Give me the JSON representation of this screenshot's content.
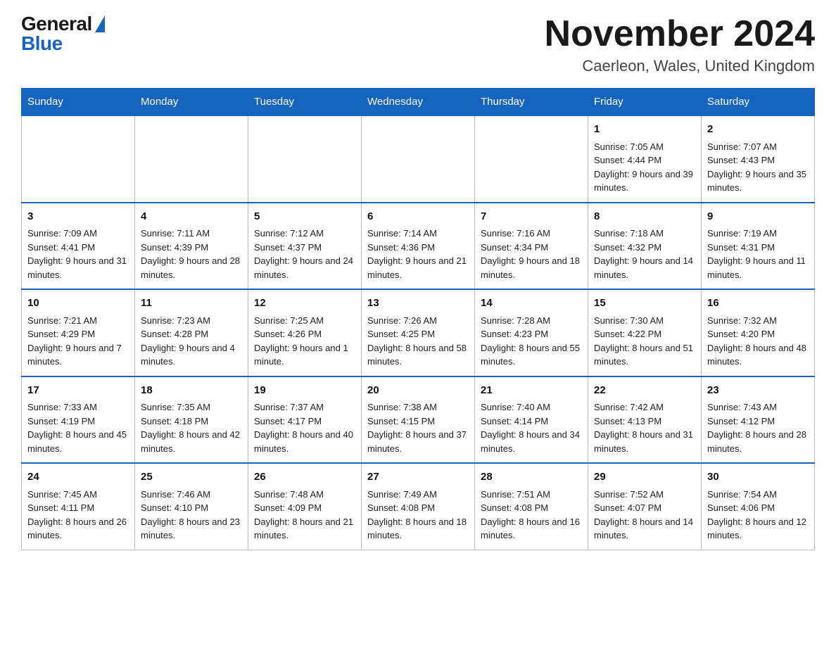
{
  "header": {
    "logo_general": "General",
    "logo_blue": "Blue",
    "title": "November 2024",
    "location": "Caerleon, Wales, United Kingdom"
  },
  "days_of_week": [
    "Sunday",
    "Monday",
    "Tuesday",
    "Wednesday",
    "Thursday",
    "Friday",
    "Saturday"
  ],
  "weeks": [
    [
      {
        "day": "",
        "empty": true
      },
      {
        "day": "",
        "empty": true
      },
      {
        "day": "",
        "empty": true
      },
      {
        "day": "",
        "empty": true
      },
      {
        "day": "",
        "empty": true
      },
      {
        "day": "1",
        "sunrise": "7:05 AM",
        "sunset": "4:44 PM",
        "daylight": "9 hours and 39 minutes."
      },
      {
        "day": "2",
        "sunrise": "7:07 AM",
        "sunset": "4:43 PM",
        "daylight": "9 hours and 35 minutes."
      }
    ],
    [
      {
        "day": "3",
        "sunrise": "7:09 AM",
        "sunset": "4:41 PM",
        "daylight": "9 hours and 31 minutes."
      },
      {
        "day": "4",
        "sunrise": "7:11 AM",
        "sunset": "4:39 PM",
        "daylight": "9 hours and 28 minutes."
      },
      {
        "day": "5",
        "sunrise": "7:12 AM",
        "sunset": "4:37 PM",
        "daylight": "9 hours and 24 minutes."
      },
      {
        "day": "6",
        "sunrise": "7:14 AM",
        "sunset": "4:36 PM",
        "daylight": "9 hours and 21 minutes."
      },
      {
        "day": "7",
        "sunrise": "7:16 AM",
        "sunset": "4:34 PM",
        "daylight": "9 hours and 18 minutes."
      },
      {
        "day": "8",
        "sunrise": "7:18 AM",
        "sunset": "4:32 PM",
        "daylight": "9 hours and 14 minutes."
      },
      {
        "day": "9",
        "sunrise": "7:19 AM",
        "sunset": "4:31 PM",
        "daylight": "9 hours and 11 minutes."
      }
    ],
    [
      {
        "day": "10",
        "sunrise": "7:21 AM",
        "sunset": "4:29 PM",
        "daylight": "9 hours and 7 minutes."
      },
      {
        "day": "11",
        "sunrise": "7:23 AM",
        "sunset": "4:28 PM",
        "daylight": "9 hours and 4 minutes."
      },
      {
        "day": "12",
        "sunrise": "7:25 AM",
        "sunset": "4:26 PM",
        "daylight": "9 hours and 1 minute."
      },
      {
        "day": "13",
        "sunrise": "7:26 AM",
        "sunset": "4:25 PM",
        "daylight": "8 hours and 58 minutes."
      },
      {
        "day": "14",
        "sunrise": "7:28 AM",
        "sunset": "4:23 PM",
        "daylight": "8 hours and 55 minutes."
      },
      {
        "day": "15",
        "sunrise": "7:30 AM",
        "sunset": "4:22 PM",
        "daylight": "8 hours and 51 minutes."
      },
      {
        "day": "16",
        "sunrise": "7:32 AM",
        "sunset": "4:20 PM",
        "daylight": "8 hours and 48 minutes."
      }
    ],
    [
      {
        "day": "17",
        "sunrise": "7:33 AM",
        "sunset": "4:19 PM",
        "daylight": "8 hours and 45 minutes."
      },
      {
        "day": "18",
        "sunrise": "7:35 AM",
        "sunset": "4:18 PM",
        "daylight": "8 hours and 42 minutes."
      },
      {
        "day": "19",
        "sunrise": "7:37 AM",
        "sunset": "4:17 PM",
        "daylight": "8 hours and 40 minutes."
      },
      {
        "day": "20",
        "sunrise": "7:38 AM",
        "sunset": "4:15 PM",
        "daylight": "8 hours and 37 minutes."
      },
      {
        "day": "21",
        "sunrise": "7:40 AM",
        "sunset": "4:14 PM",
        "daylight": "8 hours and 34 minutes."
      },
      {
        "day": "22",
        "sunrise": "7:42 AM",
        "sunset": "4:13 PM",
        "daylight": "8 hours and 31 minutes."
      },
      {
        "day": "23",
        "sunrise": "7:43 AM",
        "sunset": "4:12 PM",
        "daylight": "8 hours and 28 minutes."
      }
    ],
    [
      {
        "day": "24",
        "sunrise": "7:45 AM",
        "sunset": "4:11 PM",
        "daylight": "8 hours and 26 minutes."
      },
      {
        "day": "25",
        "sunrise": "7:46 AM",
        "sunset": "4:10 PM",
        "daylight": "8 hours and 23 minutes."
      },
      {
        "day": "26",
        "sunrise": "7:48 AM",
        "sunset": "4:09 PM",
        "daylight": "8 hours and 21 minutes."
      },
      {
        "day": "27",
        "sunrise": "7:49 AM",
        "sunset": "4:08 PM",
        "daylight": "8 hours and 18 minutes."
      },
      {
        "day": "28",
        "sunrise": "7:51 AM",
        "sunset": "4:08 PM",
        "daylight": "8 hours and 16 minutes."
      },
      {
        "day": "29",
        "sunrise": "7:52 AM",
        "sunset": "4:07 PM",
        "daylight": "8 hours and 14 minutes."
      },
      {
        "day": "30",
        "sunrise": "7:54 AM",
        "sunset": "4:06 PM",
        "daylight": "8 hours and 12 minutes."
      }
    ]
  ]
}
